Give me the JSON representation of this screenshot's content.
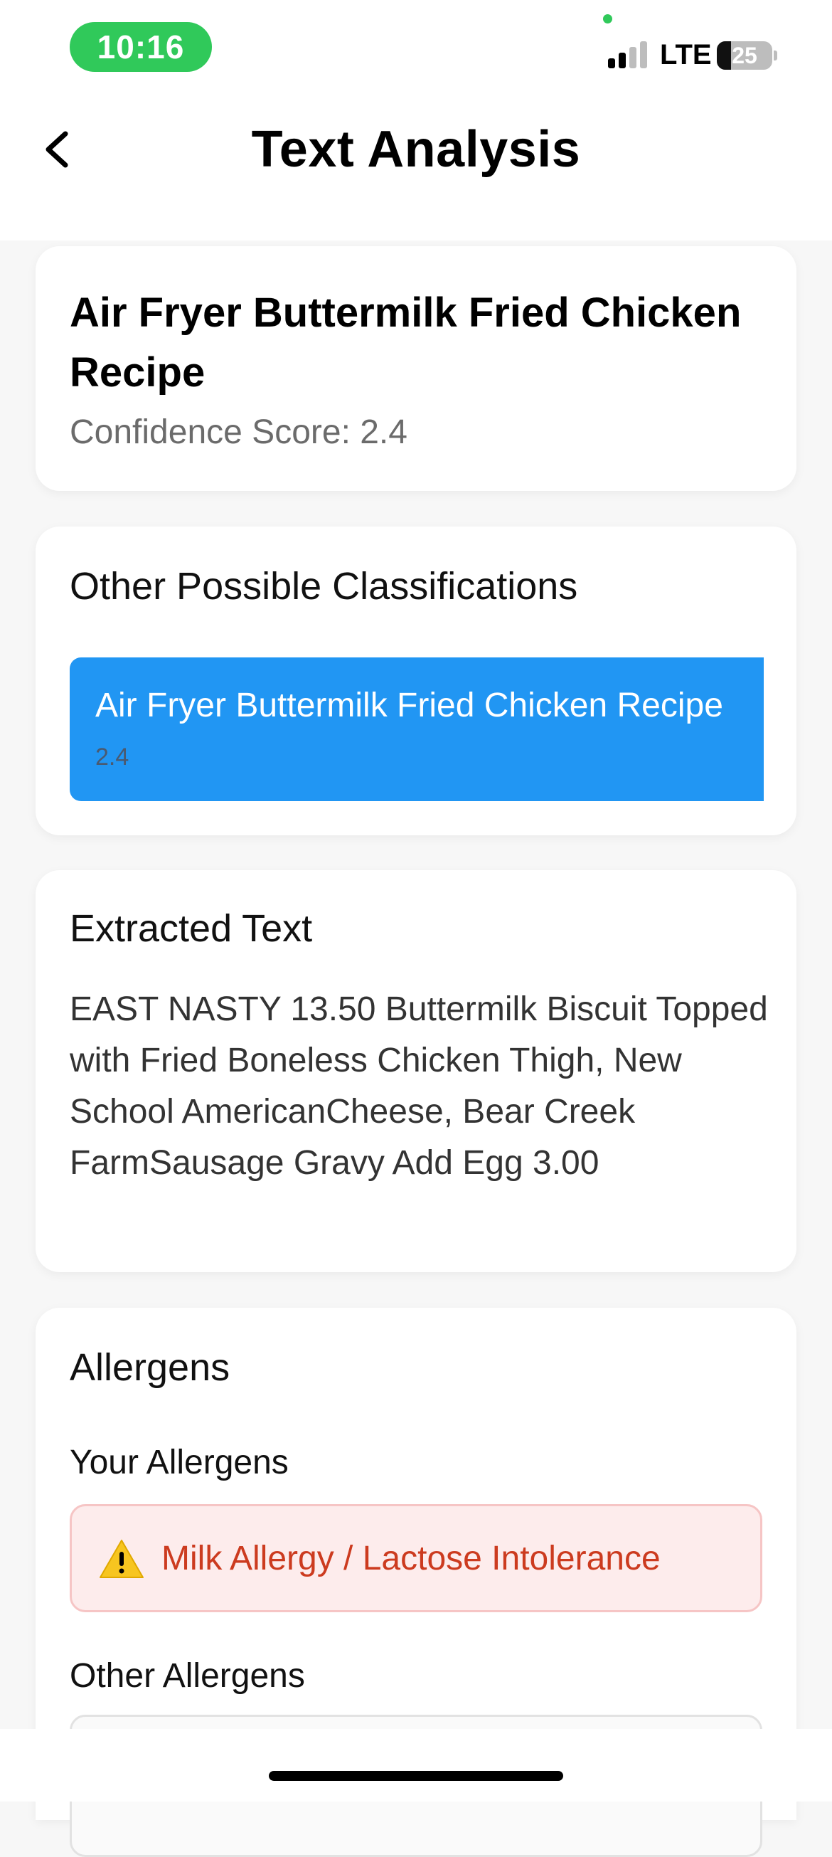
{
  "status_bar": {
    "time": "10:16",
    "network": "LTE",
    "battery_level": "25"
  },
  "header": {
    "title": "Text Analysis"
  },
  "result": {
    "title": "Air Fryer Buttermilk Fried Chicken Recipe",
    "confidence_text": "Confidence Score: 2.4"
  },
  "classifications": {
    "section_title": "Other Possible Classifications",
    "items": [
      {
        "name": "Air Fryer Buttermilk Fried Chicken Recipe",
        "score": "2.4"
      }
    ]
  },
  "extracted": {
    "section_title": "Extracted Text",
    "text": "EAST NASTY 13.50 Buttermilk Biscuit Topped with Fried Boneless Chicken Thigh, New School AmericanCheese, Bear Creek FarmSausage Gravy Add Egg 3.00"
  },
  "allergens": {
    "section_title": "Allergens",
    "your_title": "Your Allergens",
    "your_items": [
      "Milk Allergy / Lactose Intolerance"
    ],
    "other_title": "Other Allergens"
  },
  "colors": {
    "accent_blue": "#2196f3",
    "status_green": "#30c95a",
    "alert_red": "#cc3b1f",
    "alert_bg": "#fdecec"
  },
  "icons": {
    "back": "chevron-left-icon",
    "warning": "warning-icon"
  }
}
